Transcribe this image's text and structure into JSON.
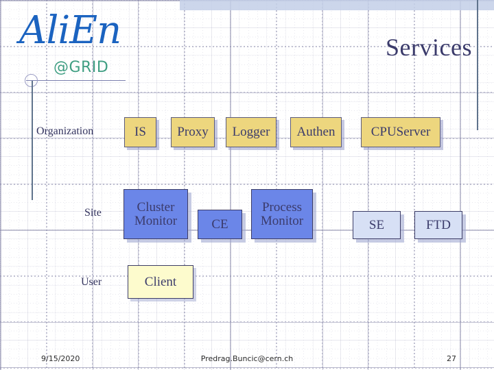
{
  "slide": {
    "title": "Services",
    "logo": {
      "name": "AliEn",
      "subtitle": "@GRID"
    }
  },
  "rows": [
    {
      "label": "Organization"
    },
    {
      "label": "Site"
    },
    {
      "label": "User"
    }
  ],
  "nodes": {
    "organization": [
      {
        "label": "IS"
      },
      {
        "label": "Proxy"
      },
      {
        "label": "Logger"
      },
      {
        "label": "Authen"
      },
      {
        "label": "CPUServer"
      }
    ],
    "site": [
      {
        "label": "Cluster\nMonitor"
      },
      {
        "label": "CE"
      },
      {
        "label": "Process\nMonitor"
      },
      {
        "label": "SE"
      },
      {
        "label": "FTD"
      }
    ],
    "user": [
      {
        "label": "Client"
      }
    ]
  },
  "footer": {
    "date": "9/15/2020",
    "center": "Predrag.Buncic@cern.ch",
    "page": "27"
  },
  "colors": {
    "logo_blue": "#1b63c0",
    "logo_green": "#3f9e82",
    "title_navy": "#3b3b6b",
    "org_box": "#edd67e",
    "site_box_blue": "#6b86e8",
    "site_box_pale": "#d7e0f5",
    "user_box": "#fdfbcd",
    "rule_line": "#5f738c",
    "top_band": "#c3cfe8"
  }
}
